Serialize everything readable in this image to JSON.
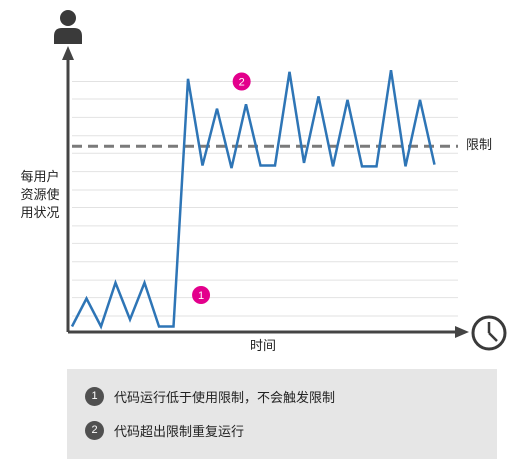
{
  "chart_data": {
    "type": "line",
    "ylabel": "每用户\n资源使\n用状况",
    "xlabel": "时间",
    "x": [
      0,
      1,
      2,
      3,
      4,
      5,
      6,
      7,
      8,
      9,
      10,
      11,
      12,
      13,
      14,
      15,
      16,
      17,
      18,
      19,
      20,
      21,
      22,
      23,
      24,
      25,
      26
    ],
    "values": [
      4,
      36,
      4,
      54,
      12,
      54,
      4,
      4,
      287,
      188,
      253,
      185,
      258,
      188,
      188,
      295,
      191,
      267,
      187,
      263,
      187,
      187,
      297,
      187,
      263,
      189
    ],
    "limit": 210,
    "ylim": [
      0,
      320
    ],
    "grid": true,
    "series_color": "#2e75b6",
    "limit_color": "#7a7a7a",
    "limit_label": "限制",
    "markers": [
      {
        "label": "1",
        "x": 8.9,
        "y": 40
      },
      {
        "label": "2",
        "x": 11.7,
        "y": 284
      }
    ],
    "marker_color": "#e3008c"
  },
  "legend": {
    "items": [
      {
        "num": "1",
        "text": "代码运行低于使用限制，不会触发限制"
      },
      {
        "num": "2",
        "text": "代码超出限制重复运行"
      }
    ]
  },
  "icons": {
    "user": "user-icon",
    "clock": "clock-icon"
  }
}
